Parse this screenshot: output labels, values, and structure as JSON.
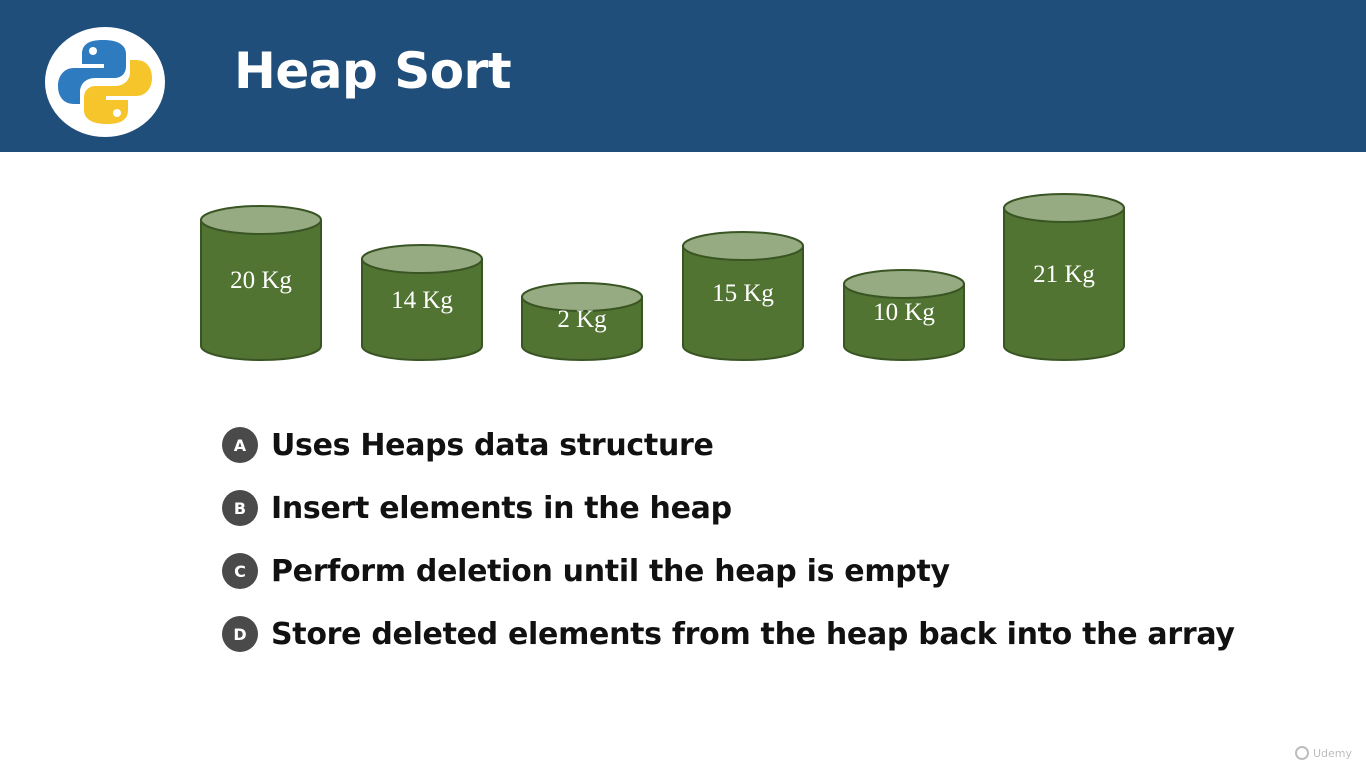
{
  "slide": {
    "title": "Heap Sort",
    "logo_icon": "python-logo-icon"
  },
  "cylinders": [
    {
      "label": "20 Kg",
      "weight": 20
    },
    {
      "label": "14 Kg",
      "weight": 14
    },
    {
      "label": "2 Kg",
      "weight": 2
    },
    {
      "label": "15 Kg",
      "weight": 15
    },
    {
      "label": "10 Kg",
      "weight": 10
    },
    {
      "label": "21 Kg",
      "weight": 21
    }
  ],
  "points": [
    {
      "badge": "A",
      "text": "Uses Heaps data structure"
    },
    {
      "badge": "B",
      "text": "Insert elements in the heap"
    },
    {
      "badge": "C",
      "text": "Perform deletion until the heap is empty"
    },
    {
      "badge": "D",
      "text": "Store deleted elements from the heap back into the array"
    }
  ],
  "colors": {
    "header": "#1f4e7b",
    "cylinder_body": "#527433",
    "cylinder_top": "#96ab82",
    "cylinder_stroke": "#3a5524",
    "badge": "#4a4a4a",
    "python_blue": "#2f7bc0",
    "python_yellow": "#f5c52b"
  },
  "watermark": {
    "text": "Udemy",
    "icon": "udemy-icon"
  }
}
